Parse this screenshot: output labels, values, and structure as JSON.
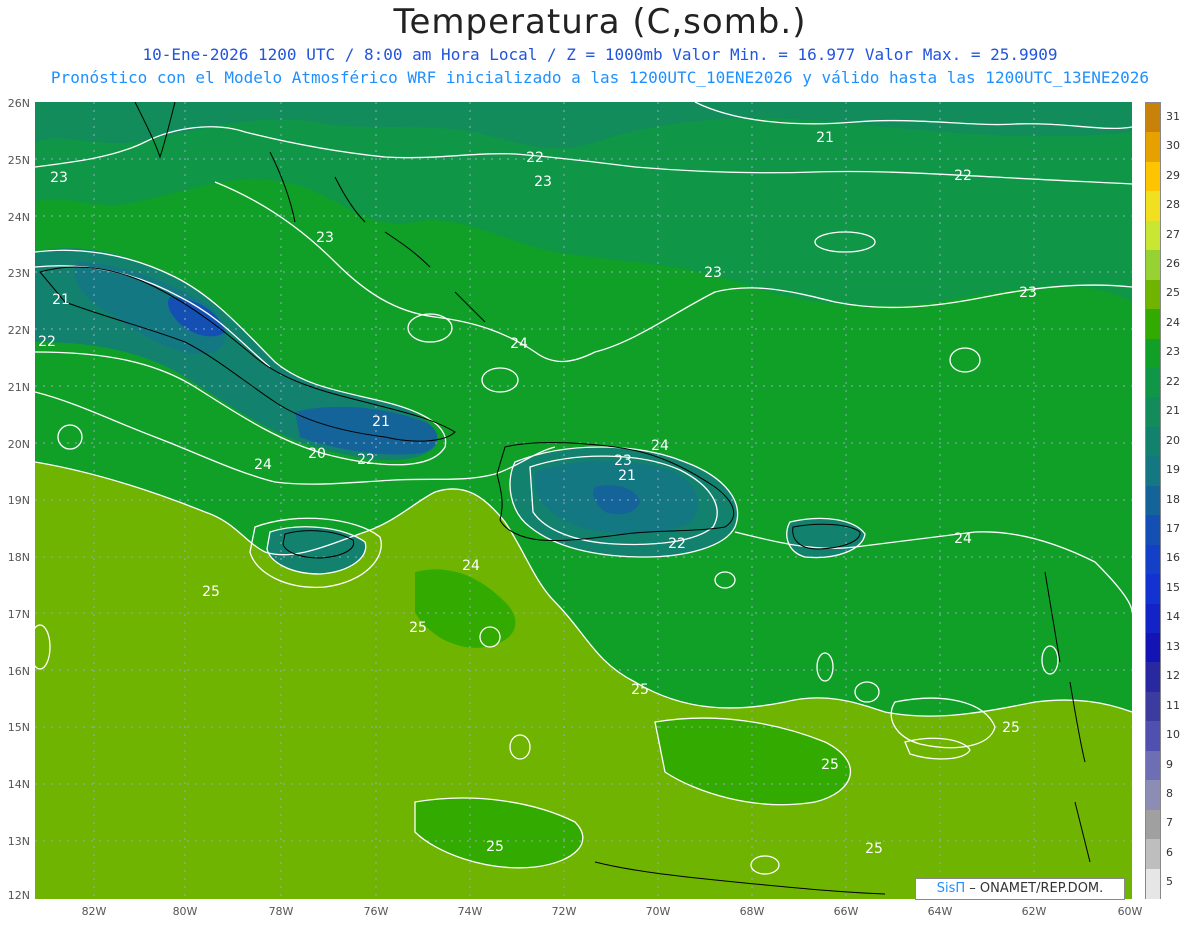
{
  "header": {
    "title": "Temperatura (C,somb.)",
    "line1": "10-Ene-2026  1200 UTC / 8:00 am Hora Local / Z = 1000mb    Valor Min. = 16.977  Valor Max. = 25.9909",
    "line2": "Pronóstico con el Modelo Atmosférico WRF inicializado a las 1200UTC_10ENE2026 y válido hasta las  1200UTC_13ENE2026"
  },
  "axes": {
    "lat_labels": [
      "26N",
      "25N",
      "24N",
      "23N",
      "22N",
      "21N",
      "20N",
      "19N",
      "18N",
      "17N",
      "16N",
      "15N",
      "14N",
      "13N",
      "12N"
    ],
    "lon_labels": [
      "82W",
      "80W",
      "78W",
      "76W",
      "74W",
      "72W",
      "70W",
      "68W",
      "66W",
      "64W",
      "62W",
      "60W"
    ]
  },
  "legend": {
    "labels": [
      "31",
      "30",
      "29",
      "28",
      "27",
      "26",
      "25",
      "24",
      "23",
      "22",
      "21",
      "20",
      "19",
      "18",
      "17",
      "16",
      "15",
      "14",
      "13",
      "12",
      "11",
      "10",
      "9",
      "8",
      "7",
      "6",
      "5"
    ],
    "colors": [
      "#c8820a",
      "#e6a000",
      "#ffc400",
      "#f0e020",
      "#c8e632",
      "#96d232",
      "#6eb400",
      "#32aa00",
      "#10a028",
      "#0f9646",
      "#118c5a",
      "#12826e",
      "#147882",
      "#14649a",
      "#1450b4",
      "#1440c8",
      "#1432d2",
      "#1423c8",
      "#1414b4",
      "#2828a0",
      "#3c3ca0",
      "#5050b0",
      "#6e6eb4",
      "#8c8cb4",
      "#a0a0a0",
      "#bebebe",
      "#e6e6e6"
    ]
  },
  "credit": {
    "brand": "SisΠ",
    "text": " – ONAMET/REP.DOM."
  },
  "contour_labels": [
    {
      "text": "21"
    },
    {
      "text": "22"
    },
    {
      "text": "22"
    },
    {
      "text": "23"
    },
    {
      "text": "23"
    },
    {
      "text": "23"
    },
    {
      "text": "23"
    },
    {
      "text": "23"
    },
    {
      "text": "24"
    },
    {
      "text": "21"
    },
    {
      "text": "22"
    },
    {
      "text": "21"
    },
    {
      "text": "20"
    },
    {
      "text": "22"
    },
    {
      "text": "24"
    },
    {
      "text": "24"
    },
    {
      "text": "23"
    },
    {
      "text": "21"
    },
    {
      "text": "22"
    },
    {
      "text": "24"
    },
    {
      "text": "24"
    },
    {
      "text": "25"
    },
    {
      "text": "25"
    },
    {
      "text": "25"
    },
    {
      "text": "25"
    },
    {
      "text": "25"
    },
    {
      "text": "25"
    },
    {
      "text": "25"
    }
  ],
  "colors": {
    "sea_light": "#32aa00",
    "sea_mid": "#10a028",
    "sea_dark": "#0f9646",
    "sea_darker": "#118c5a",
    "south_warm": "#6eb400",
    "core": "#147882",
    "contour": "#ffffff",
    "coast": "#000000",
    "grid": "#9aa8c8"
  }
}
